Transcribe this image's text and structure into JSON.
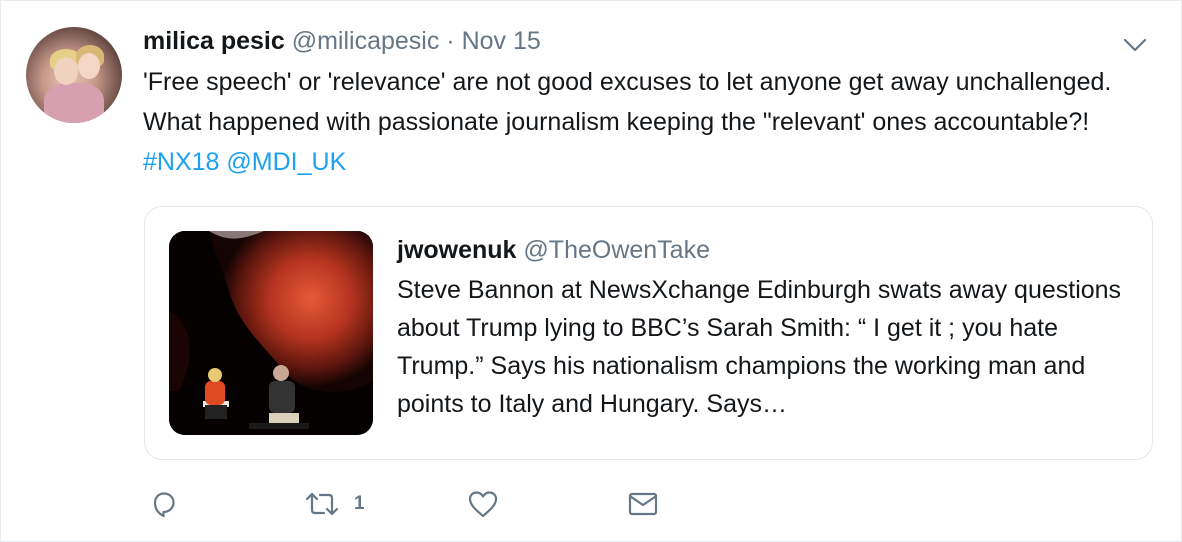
{
  "tweet": {
    "author_name": "milica pesic",
    "author_handle": "@milicapesic",
    "separator": "·",
    "date": "Nov 15",
    "text_plain": "'Free speech' or 'relevance' are not good excuses to let anyone get away unchallenged. What happened with passionate journalism keeping the \"relevant' ones accountable?!",
    "hashtag": "#NX18",
    "mention": "@MDI_UK"
  },
  "quoted_tweet": {
    "author_name": "jwowenuk",
    "author_handle": "@TheOwenTake",
    "text": "Steve Bannon at NewsXchange Edinburgh swats away questions about Trump lying to BBC’s Sarah Smith: “ I get it ; you hate Trump.” Says his nationalism champions the working man and points to Italy and Hungary. Says…"
  },
  "actions": {
    "reply_icon": "reply-icon",
    "retweet_icon": "retweet-icon",
    "retweet_count": "1",
    "like_icon": "heart-icon",
    "dm_icon": "envelope-icon"
  },
  "colors": {
    "link": "#1da1f2",
    "secondary_text": "#657786",
    "border": "#e1e8ed"
  }
}
